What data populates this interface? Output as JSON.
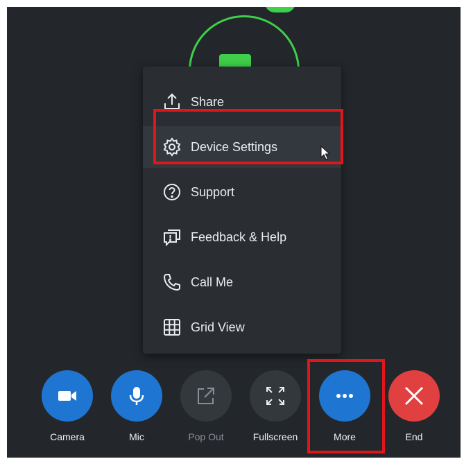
{
  "menu": {
    "items": [
      {
        "label": "Share",
        "icon": "upload-icon"
      },
      {
        "label": "Device Settings",
        "icon": "gear-icon"
      },
      {
        "label": "Support",
        "icon": "question-icon"
      },
      {
        "label": "Feedback & Help",
        "icon": "feedback-icon"
      },
      {
        "label": "Call Me",
        "icon": "phone-icon"
      },
      {
        "label": "Grid View",
        "icon": "grid-icon"
      }
    ]
  },
  "controls": {
    "buttons": [
      {
        "label": "Camera",
        "icon": "camera-icon",
        "color": "#1f76d2"
      },
      {
        "label": "Mic",
        "icon": "mic-icon",
        "color": "#1f76d2"
      },
      {
        "label": "Pop Out",
        "icon": "pop-out-icon",
        "color": "#33383d"
      },
      {
        "label": "Fullscreen",
        "icon": "fullscreen-icon",
        "color": "#33383d"
      },
      {
        "label": "More",
        "icon": "more-dots-icon",
        "color": "#1f76d2"
      },
      {
        "label": "End",
        "icon": "close-icon",
        "color": "#e04040"
      }
    ]
  },
  "colors": {
    "highlight": "#e0161b",
    "accent_green": "#3fcf4a"
  }
}
